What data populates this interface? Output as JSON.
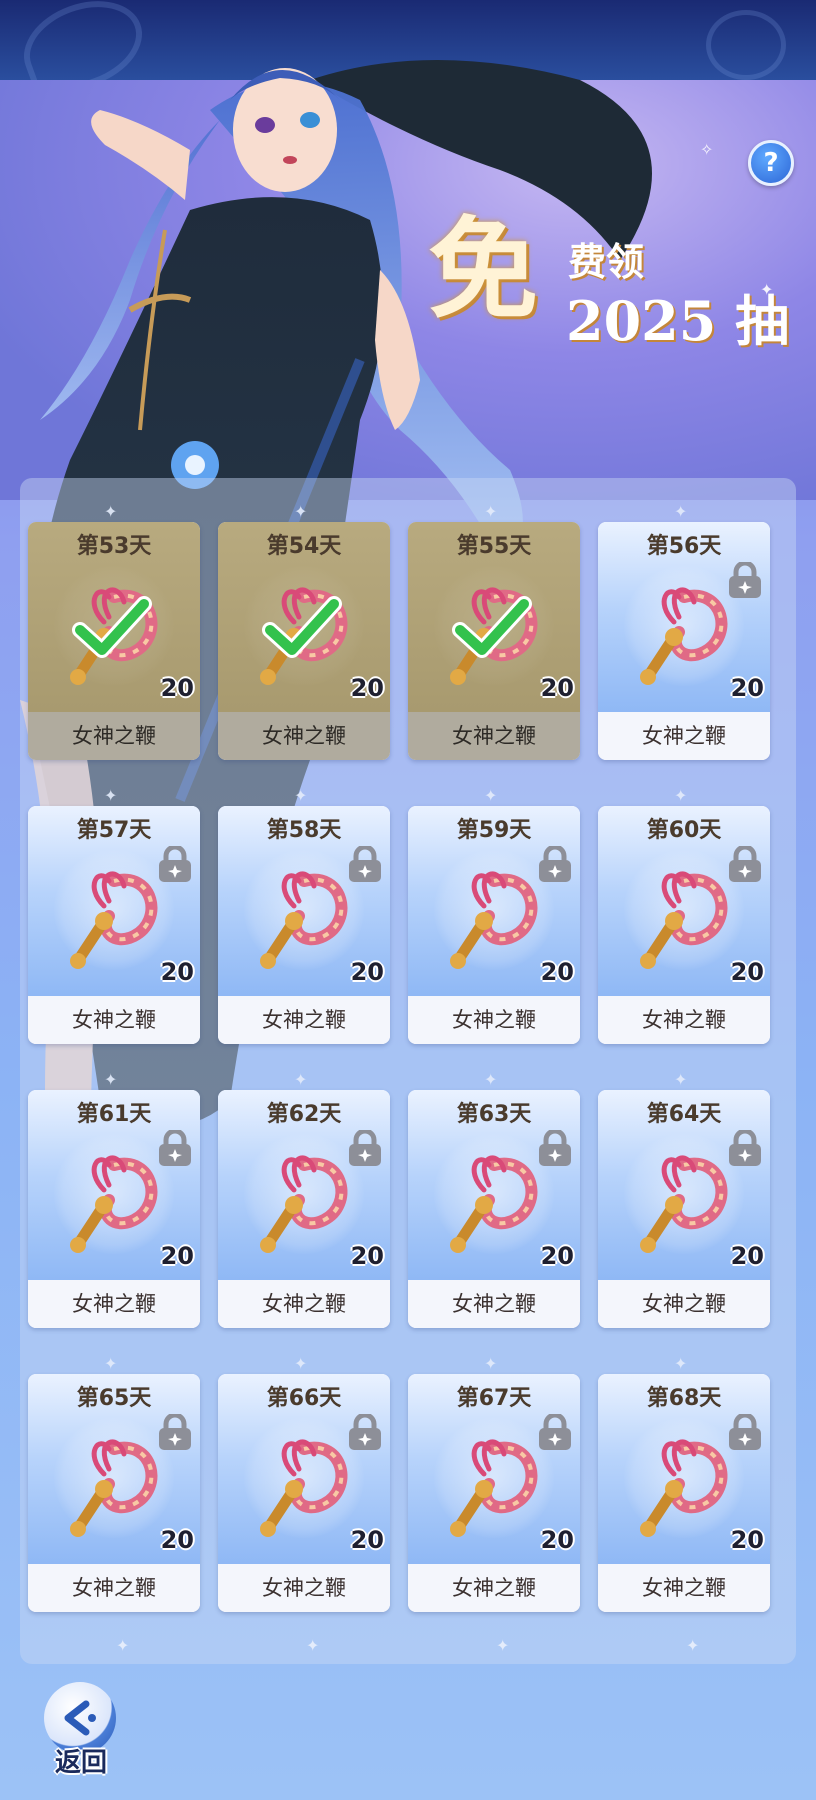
{
  "header": {
    "help_icon": "question-icon",
    "help_label": "?"
  },
  "promo": {
    "big_char": "免",
    "line1": "费领",
    "line2": "2025 抽"
  },
  "cards": [
    {
      "day": "第53天",
      "name": "女神之鞭",
      "qty": "20",
      "status": "claimed"
    },
    {
      "day": "第54天",
      "name": "女神之鞭",
      "qty": "20",
      "status": "claimed"
    },
    {
      "day": "第55天",
      "name": "女神之鞭",
      "qty": "20",
      "status": "claimed"
    },
    {
      "day": "第56天",
      "name": "女神之鞭",
      "qty": "20",
      "status": "locked"
    },
    {
      "day": "第57天",
      "name": "女神之鞭",
      "qty": "20",
      "status": "locked"
    },
    {
      "day": "第58天",
      "name": "女神之鞭",
      "qty": "20",
      "status": "locked"
    },
    {
      "day": "第59天",
      "name": "女神之鞭",
      "qty": "20",
      "status": "locked"
    },
    {
      "day": "第60天",
      "name": "女神之鞭",
      "qty": "20",
      "status": "locked"
    },
    {
      "day": "第61天",
      "name": "女神之鞭",
      "qty": "20",
      "status": "locked"
    },
    {
      "day": "第62天",
      "name": "女神之鞭",
      "qty": "20",
      "status": "locked"
    },
    {
      "day": "第63天",
      "name": "女神之鞭",
      "qty": "20",
      "status": "locked"
    },
    {
      "day": "第64天",
      "name": "女神之鞭",
      "qty": "20",
      "status": "locked"
    },
    {
      "day": "第65天",
      "name": "女神之鞭",
      "qty": "20",
      "status": "locked"
    },
    {
      "day": "第66天",
      "name": "女神之鞭",
      "qty": "20",
      "status": "locked"
    },
    {
      "day": "第67天",
      "name": "女神之鞭",
      "qty": "20",
      "status": "locked"
    },
    {
      "day": "第68天",
      "name": "女神之鞭",
      "qty": "20",
      "status": "locked"
    }
  ],
  "footer": {
    "back_label": "返回",
    "back_icon": "back-arrow-icon"
  },
  "colors": {
    "accent": "#2d66d6",
    "claimed_overlay": "#a89a6f",
    "check": "#33c24d"
  }
}
